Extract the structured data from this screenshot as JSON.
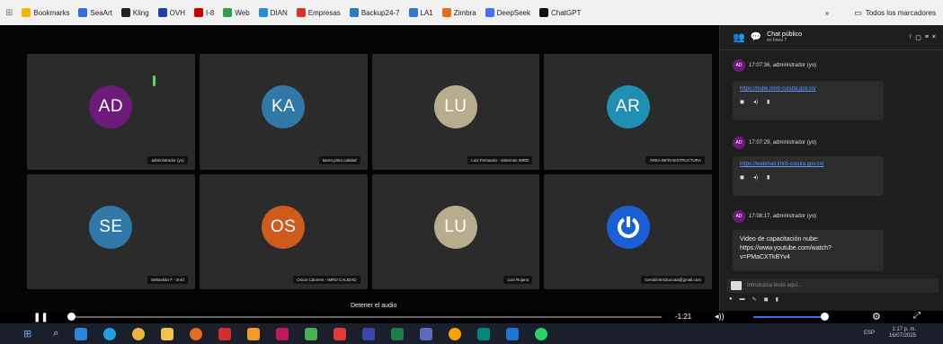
{
  "bookmarks": {
    "items": [
      {
        "label": "Bookmarks",
        "color": "#f4b400"
      },
      {
        "label": "SeaArt",
        "color": "#2f6fe4"
      },
      {
        "label": "Kling",
        "color": "#222222"
      },
      {
        "label": "OVH",
        "color": "#1f3fa8"
      },
      {
        "label": "I-8",
        "color": "#cc0000"
      },
      {
        "label": "Web",
        "color": "#2e9e4a"
      },
      {
        "label": "DIAN",
        "color": "#1f8fd6"
      },
      {
        "label": "Empresas",
        "color": "#d8342b"
      },
      {
        "label": "Backup24-7",
        "color": "#2c79c6"
      },
      {
        "label": "LA1",
        "color": "#2b7bd1"
      },
      {
        "label": "Zimbra",
        "color": "#e06e1a"
      },
      {
        "label": "DeepSeek",
        "color": "#4b6bfb"
      },
      {
        "label": "ChatGPT",
        "color": "#111111"
      }
    ],
    "more": "»",
    "all_bookmarks": "Todos los marcadores"
  },
  "meeting": {
    "tiles": [
      {
        "initials": "AD",
        "color": "#6d1b7b",
        "label": "administrador (yo)"
      },
      {
        "initials": "KA",
        "color": "#2f78a8",
        "label": "karen.pinto.calidad"
      },
      {
        "initials": "LU",
        "color": "#b7ad8c",
        "label": "Luis Fernando - Sistemas IMRD"
      },
      {
        "initials": "AR",
        "color": "#1f8fb3",
        "label": "ÁREA INFRAESTRUCTURA"
      },
      {
        "initials": "SE",
        "color": "#2f78a8",
        "label": "Sebastián F - imrd"
      },
      {
        "initials": "OS",
        "color": "#cf5a1e",
        "label": "Oscar Cáceres - IMRD CALIDAD"
      },
      {
        "initials": "LU",
        "color": "#b7ad8c",
        "label": "Luis Rojano"
      },
      {
        "initials": "",
        "color": "#1b5fd6",
        "label": "Gestiónimrdcucuta@gmail.com"
      }
    ],
    "stop_audio": "Detener el audio"
  },
  "chat": {
    "title": "Chat público",
    "subtitle": "en línea 7",
    "messages": [
      {
        "avatar": "AD",
        "header": "17:07:36, administrador (yo)",
        "link": "https://nube.imrd-cucuta.gov.co/"
      },
      {
        "avatar": "AD",
        "header": "17:07:29, administrador (yo)",
        "link": "https://webmail.imrd-cucuta.gov.co/"
      },
      {
        "avatar": "AD",
        "header": "17:08:17, administrador (yo)",
        "text": "Video de capacitación nube: https://www.youtube.com/watch?v=PMaCXTkBYv4"
      }
    ],
    "input_placeholder": "Introduzca texto aquí..."
  },
  "player": {
    "time_left": "-1:21",
    "progress_fraction": 0.01,
    "volume_fraction": 1.0
  },
  "taskbar": {
    "lang": "ESP",
    "time": "1:17 p. m.",
    "date": "16/07/2025"
  }
}
